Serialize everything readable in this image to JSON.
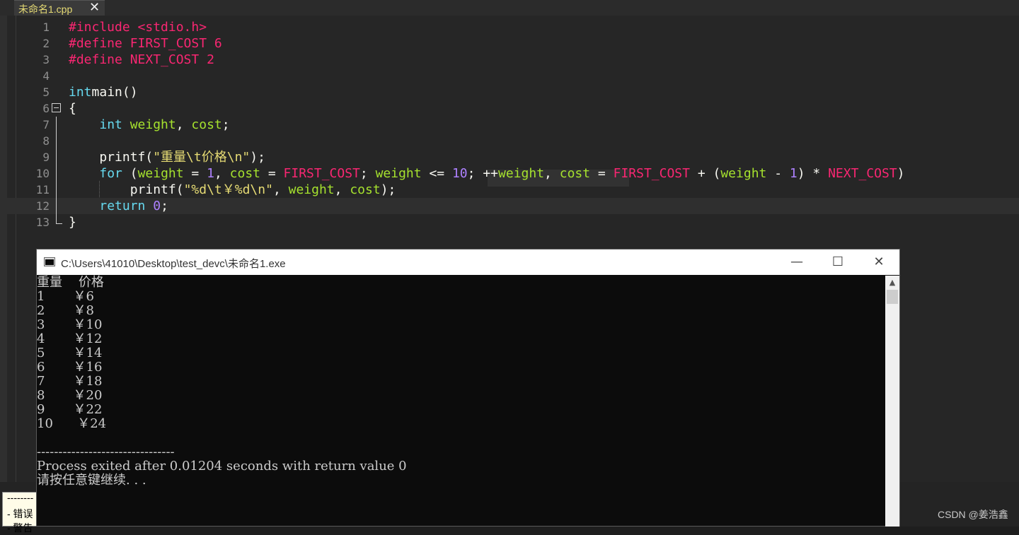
{
  "tab": {
    "label": "未命名1.cpp",
    "close": "✕"
  },
  "editor": {
    "lines": [
      {
        "n": "1",
        "segs": [
          [
            "pre",
            "#include <stdio.h>"
          ]
        ]
      },
      {
        "n": "2",
        "segs": [
          [
            "pre",
            "#define FIRST_COST 6"
          ]
        ]
      },
      {
        "n": "3",
        "segs": [
          [
            "pre",
            "#define NEXT_COST 2"
          ]
        ]
      },
      {
        "n": "4",
        "segs": []
      },
      {
        "n": "5",
        "segs": [
          [
            "kw",
            "int"
          ],
          [
            "",
            "main()"
          ]
        ]
      },
      {
        "n": "6",
        "segs": [
          [
            "",
            "{"
          ]
        ]
      },
      {
        "n": "7",
        "segs": [
          [
            "",
            "    "
          ],
          [
            "kw",
            "int"
          ],
          [
            "var",
            " weight"
          ],
          [
            "",
            ", "
          ],
          [
            "var",
            "cost"
          ],
          [
            "",
            ";"
          ]
        ]
      },
      {
        "n": "8",
        "segs": []
      },
      {
        "n": "9",
        "segs": [
          [
            "",
            "    printf("
          ],
          [
            "str",
            "\"重量\\t价格\\n\""
          ],
          [
            "",
            ");"
          ]
        ]
      },
      {
        "n": "10",
        "segs": [
          [
            "",
            "    "
          ],
          [
            "kw",
            "for"
          ],
          [
            "",
            " ("
          ],
          [
            "var",
            "weight"
          ],
          [
            "",
            " = "
          ],
          [
            "num",
            "1"
          ],
          [
            "",
            ", "
          ],
          [
            "var",
            "cost"
          ],
          [
            "",
            " = "
          ],
          [
            "mac",
            "FIRST_COST"
          ],
          [
            "",
            "; "
          ],
          [
            "var",
            "weight"
          ],
          [
            "",
            " <= "
          ],
          [
            "num",
            "10"
          ],
          [
            "",
            "; ++"
          ],
          [
            "var",
            "weight"
          ],
          [
            "",
            ", "
          ],
          [
            "var",
            "cost"
          ],
          [
            "",
            " = "
          ],
          [
            "mac",
            "FIRST_COST"
          ],
          [
            "",
            " + ("
          ],
          [
            "var",
            "weight"
          ],
          [
            "",
            " - "
          ],
          [
            "num",
            "1"
          ],
          [
            "",
            ") * "
          ],
          [
            "mac",
            "NEXT_COST"
          ],
          [
            "",
            ")"
          ]
        ]
      },
      {
        "n": "11",
        "segs": [
          [
            "",
            "        printf("
          ],
          [
            "str",
            "\"%d\\t￥%d\\n\""
          ],
          [
            "",
            ", "
          ],
          [
            "var",
            "weight"
          ],
          [
            "",
            ", "
          ],
          [
            "var",
            "cost"
          ],
          [
            "",
            ");"
          ]
        ]
      },
      {
        "n": "12",
        "segs": [
          [
            "",
            "    "
          ],
          [
            "kw",
            "return"
          ],
          [
            " num",
            " 0"
          ],
          [
            "",
            ";"
          ]
        ]
      },
      {
        "n": "13",
        "segs": [
          [
            "",
            "}"
          ]
        ]
      }
    ]
  },
  "console": {
    "title": "C:\\Users\\41010\\Desktop\\test_devc\\未命名1.exe",
    "minimize": "—",
    "maximize": "☐",
    "close": "✕",
    "output": [
      "重量    价格",
      "1       ￥6",
      "2       ￥8",
      "3       ￥10",
      "4       ￥12",
      "5       ￥14",
      "6       ￥16",
      "7       ￥18",
      "8       ￥20",
      "9       ￥22",
      "10      ￥24",
      "",
      "--------------------------------",
      "Process exited after 0.01204 seconds with return value 0",
      "请按任意键继续. . ."
    ],
    "scroll_up": "▲"
  },
  "messages": {
    "line1": "--------",
    "line2": "- 错误",
    "line3": "- 警告"
  },
  "watermark": "CSDN @姜浩鑫"
}
